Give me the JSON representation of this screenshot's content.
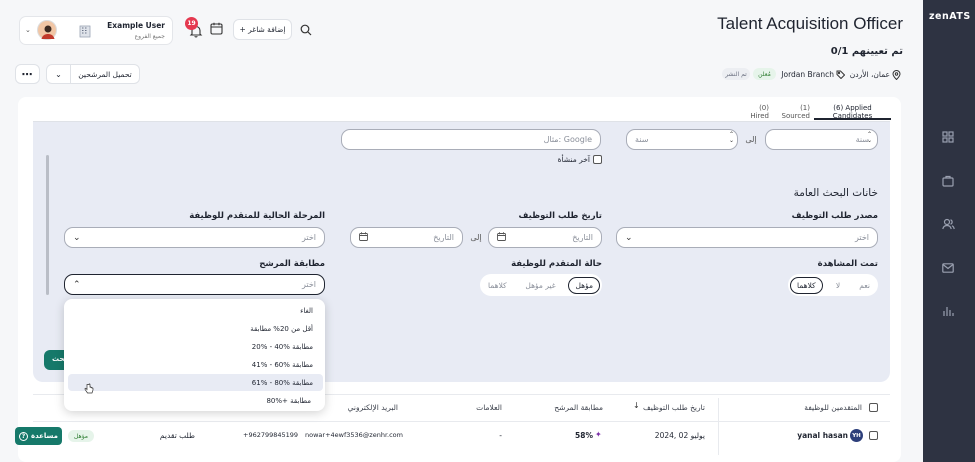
{
  "brand": {
    "logo": "zenATS"
  },
  "user": {
    "name": "Example User",
    "subtitle": "جميع الفروع"
  },
  "notifications": {
    "count": "19"
  },
  "header": {
    "add_talent": "+ إضافة شاغر",
    "job_title": "Talent Acquisition Officer",
    "hires": "0/1 تم تعيينهم",
    "location": "عمان، الأردن",
    "branch": "Jordan Branch",
    "status_open": "مُعلن",
    "status_published": "تم النشر"
  },
  "toolbar": {
    "download_candidates": "تحميل المرشحين"
  },
  "tabs": [
    {
      "label": "(0) Hired"
    },
    {
      "label": "(1) Sourced"
    },
    {
      "label": "(6) Applied Candidates"
    }
  ],
  "filters": {
    "year_from_placeholder": "سنة",
    "to_label": "إلى",
    "year_to_placeholder": "سنة",
    "company_placeholder": "مثال: Google",
    "last_facility": "آخر منشأة",
    "general_fields_title": "خانات البحث العامة",
    "source_label": "مصدر طلب التوظيف",
    "source_placeholder": "اختر",
    "date_label": "تاريخ طلب التوظيف",
    "date_from_placeholder": "التاريخ",
    "date_to_label": "إلى",
    "date_to_placeholder": "التاريخ",
    "stage_label": "المرحلة الحالية للمتقدم للوظيفة",
    "stage_placeholder": "اختر",
    "viewed_label": "تمت المشاهدة",
    "viewed_options": [
      "نعم",
      "لا",
      "كلاهما"
    ],
    "applicant_status_label": "حالة المتقدم للوظيفة",
    "applicant_status_options": [
      "مؤهل",
      "غير مؤهل",
      "كلاهما"
    ],
    "match_label": "مطابقة المرشح",
    "match_placeholder": "اختر",
    "search_button": "بحث"
  },
  "match_dropdown": {
    "options": [
      "الغاء",
      "أقل من 20% مطابقة",
      "20% - 40% مطابقة",
      "41% - 60% مطابقة",
      "61% - 80% مطابقة",
      "80%+ مطابقة"
    ]
  },
  "table": {
    "headers": {
      "applicants": "المتقدمين للوظيفة",
      "date": "تاريخ طلب التوظيف",
      "match": "مطابقة المرشح",
      "marks": "العلامات",
      "email": "البريد الإلكتروني"
    },
    "rows": [
      {
        "initials": "YH",
        "name": "yanal hasan",
        "date": "يوليو 02 ,2024",
        "match": "58%",
        "marks": "-",
        "email": "nowar+4ewf3536@zenhr.com",
        "phone": "+962799845199",
        "source": "طلب تقديم",
        "status": "مؤهل"
      }
    ]
  },
  "help": {
    "label": "مساعدة"
  },
  "colors": {
    "sidebar": "#2e3342",
    "accent": "#16796a",
    "badge_red": "#e53950",
    "avatar_blue": "#2c3e7a"
  }
}
